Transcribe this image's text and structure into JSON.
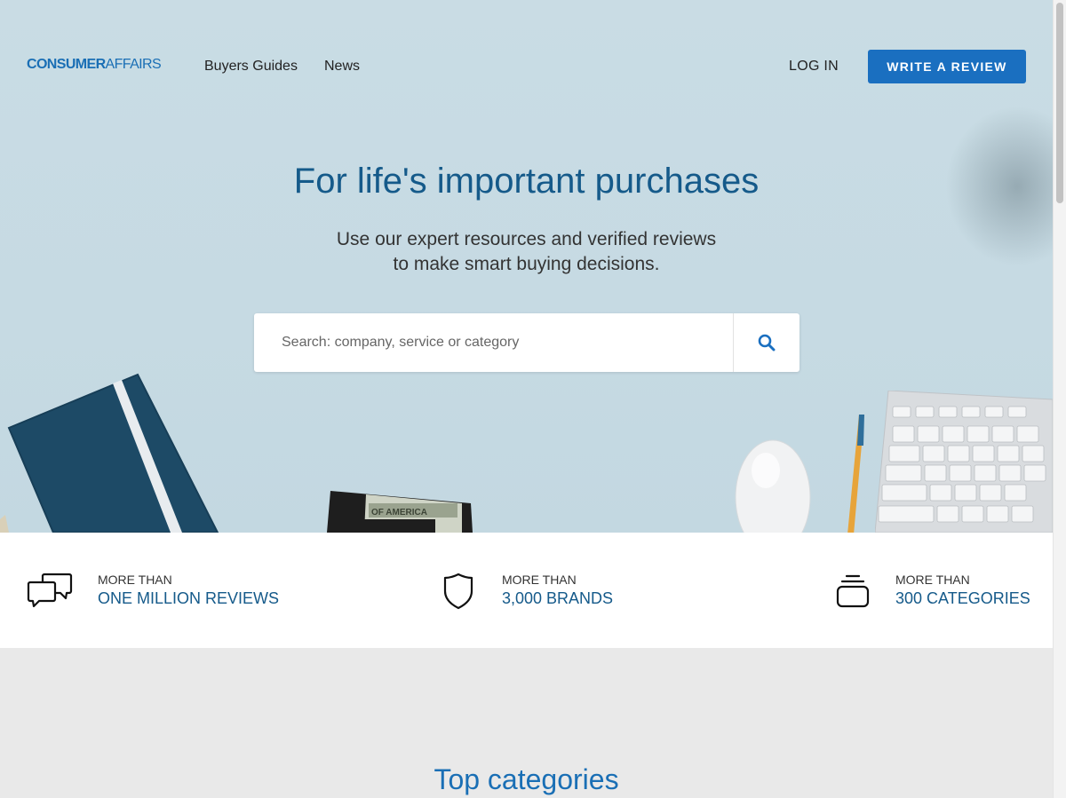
{
  "header": {
    "logo_bold": "CONSUMER",
    "logo_thin": "AFFAIRS",
    "nav": [
      "Buyers Guides",
      "News"
    ],
    "login_label": "LOG IN",
    "write_review_label": "WRITE A REVIEW"
  },
  "hero": {
    "headline": "For life's important purchases",
    "subline_1": "Use our expert resources and verified reviews",
    "subline_2": "to make smart buying decisions.",
    "search_placeholder": "Search: company, service or category",
    "search_icon": "search-icon"
  },
  "stats": [
    {
      "icon": "chat-bubbles-icon",
      "prefix": "MORE THAN",
      "value": "ONE MILLION REVIEWS"
    },
    {
      "icon": "shield-icon",
      "prefix": "MORE THAN",
      "value": "3,000 BRANDS"
    },
    {
      "icon": "stack-icon",
      "prefix": "MORE THAN",
      "value": "300 CATEGORIES"
    }
  ],
  "top_categories": {
    "title": "Top categories"
  },
  "colors": {
    "brand_blue": "#1a6fc0",
    "headline_blue": "#155a8a",
    "hero_bg": "#c9dce4"
  }
}
